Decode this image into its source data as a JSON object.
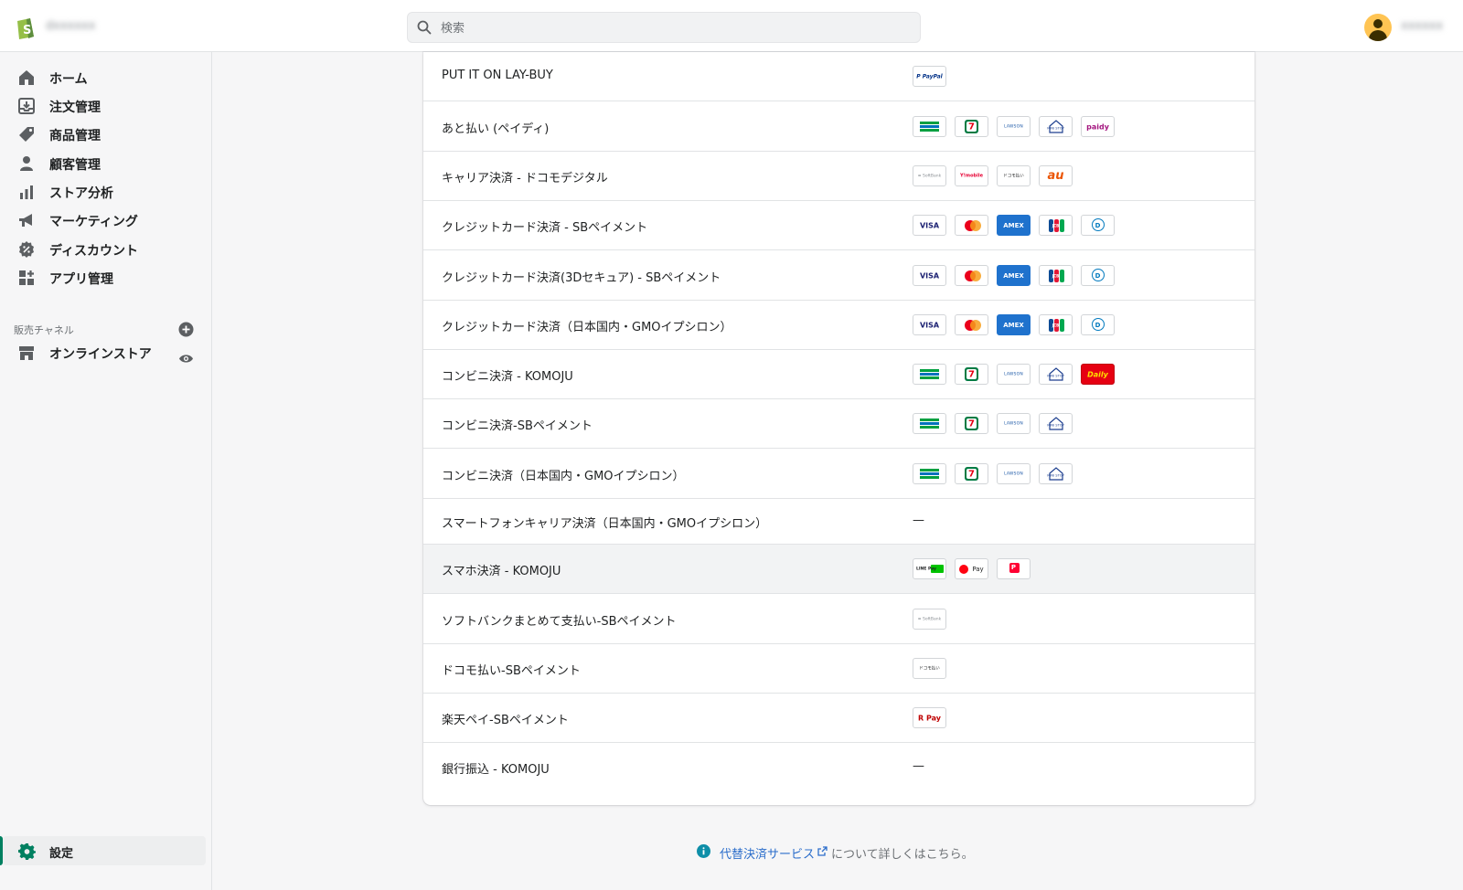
{
  "topbar": {
    "store_name": "dxxxxxx",
    "search_placeholder": "検索",
    "user_name": "xxxxxx"
  },
  "sidebar": {
    "items": [
      {
        "label": "ホーム",
        "icon": "home-icon"
      },
      {
        "label": "注文管理",
        "icon": "orders-icon"
      },
      {
        "label": "商品管理",
        "icon": "tag-icon"
      },
      {
        "label": "顧客管理",
        "icon": "customer-icon"
      },
      {
        "label": "ストア分析",
        "icon": "analytics-icon"
      },
      {
        "label": "マーケティング",
        "icon": "megaphone-icon"
      },
      {
        "label": "ディスカウント",
        "icon": "discount-icon"
      },
      {
        "label": "アプリ管理",
        "icon": "apps-icon"
      }
    ],
    "channels_title": "販売チャネル",
    "channel_item": "オンラインストア",
    "settings_label": "設定"
  },
  "providers": [
    {
      "name": "PUT IT ON LAY-BUY",
      "icons": [
        "paypal"
      ]
    },
    {
      "name": "あと払い (ペイディ)",
      "icons": [
        "familymart",
        "seven-eleven",
        "lawson",
        "ministop",
        "paidy"
      ]
    },
    {
      "name": "キャリア決済 - ドコモデジタル",
      "icons": [
        "softbank",
        "ymobile",
        "docomo",
        "au"
      ]
    },
    {
      "name": "クレジットカード決済 - SBペイメント",
      "icons": [
        "visa",
        "mastercard",
        "amex",
        "jcb",
        "diners"
      ]
    },
    {
      "name": "クレジットカード決済(3Dセキュア) - SBペイメント",
      "icons": [
        "visa",
        "mastercard",
        "amex",
        "jcb",
        "diners"
      ]
    },
    {
      "name": "クレジットカード決済（日本国内・GMOイプシロン）",
      "icons": [
        "visa",
        "mastercard",
        "amex",
        "jcb",
        "diners"
      ]
    },
    {
      "name": "コンビニ決済 - KOMOJU",
      "icons": [
        "familymart",
        "seven-eleven",
        "lawson",
        "ministop",
        "daily"
      ]
    },
    {
      "name": "コンビニ決済-SBペイメント",
      "icons": [
        "familymart",
        "seven-eleven",
        "lawson",
        "ministop"
      ]
    },
    {
      "name": "コンビニ決済（日本国内・GMOイプシロン）",
      "icons": [
        "familymart",
        "seven-eleven",
        "lawson",
        "ministop"
      ]
    },
    {
      "name": "スマートフォンキャリア決済（日本国内・GMOイプシロン）",
      "icons": [],
      "dash": "—"
    },
    {
      "name": "スマホ決済 - KOMOJU",
      "icons": [
        "linepay",
        "merpay",
        "paypay"
      ]
    },
    {
      "name": "ソフトバンクまとめて支払い-SBペイメント",
      "icons": [
        "softbank"
      ]
    },
    {
      "name": "ドコモ払い-SBペイメント",
      "icons": [
        "docomo"
      ]
    },
    {
      "name": "楽天ペイ-SBペイメント",
      "icons": [
        "rakutenpay"
      ]
    },
    {
      "name": "銀行振込 - KOMOJU",
      "icons": [],
      "dash": "—"
    }
  ],
  "icon_text": {
    "paypal": "P PayPal",
    "familymart": "FamilyMart",
    "seven-eleven": "7",
    "lawson": "LAWSON",
    "ministop": "MINI STOP",
    "paidy": "paidy",
    "softbank": "≡ SoftBank",
    "ymobile": "Y!mobile",
    "docomo": "ドコモ払い",
    "au": "au",
    "visa": "VISA",
    "mastercard": "",
    "amex": "AMEX",
    "jcb": "JCB",
    "diners": "D",
    "daily": "Daily",
    "linepay": "LINE Pay",
    "merpay": "Pay",
    "paypay": "P",
    "rakutenpay": "R Pay"
  },
  "footer": {
    "link_text": "代替決済サービス",
    "rest_text": "について詳しくはこちら。"
  },
  "colors": {
    "accent_green": "#008060",
    "link_blue": "#2c6ecb",
    "amex_blue": "#1f72cd",
    "daily_red": "#e60012"
  }
}
